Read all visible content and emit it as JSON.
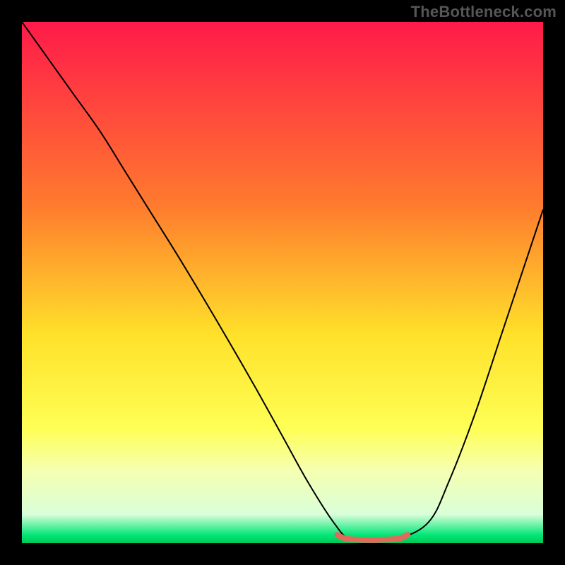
{
  "watermark": "TheBottleneck.com",
  "chart_data": {
    "type": "line",
    "title": "",
    "xlabel": "",
    "ylabel": "",
    "xlim": [
      0,
      100
    ],
    "ylim": [
      0,
      100
    ],
    "background_gradient": [
      {
        "offset": 0.0,
        "color": "#ff1a4a"
      },
      {
        "offset": 0.35,
        "color": "#ff7a2e"
      },
      {
        "offset": 0.6,
        "color": "#ffe12a"
      },
      {
        "offset": 0.78,
        "color": "#feff55"
      },
      {
        "offset": 0.86,
        "color": "#f6ffb0"
      },
      {
        "offset": 0.945,
        "color": "#d9ffd9"
      },
      {
        "offset": 0.985,
        "color": "#00e676"
      },
      {
        "offset": 1.0,
        "color": "#00c853"
      }
    ],
    "series": [
      {
        "name": "bottleneck-curve",
        "color": "#000000",
        "stroke_width": 2,
        "x": [
          0,
          5,
          10,
          15,
          20,
          25,
          30,
          35,
          40,
          45,
          50,
          55,
          60,
          63,
          68,
          72,
          78,
          82,
          87,
          92,
          96,
          100
        ],
        "y": [
          100,
          93,
          86,
          79,
          71,
          63,
          55,
          46.7,
          38.2,
          29.5,
          20.5,
          11.5,
          3.7,
          0.8,
          0.6,
          0.8,
          4.0,
          12,
          25,
          40,
          52,
          64
        ]
      },
      {
        "name": "optimal-zone",
        "color": "#e26a5a",
        "stroke_width": 8,
        "linecap": "round",
        "x": [
          60.5,
          62.0,
          64.0,
          66.0,
          68.0,
          70.0,
          72.5,
          74.0
        ],
        "y": [
          1.6,
          0.9,
          0.7,
          0.6,
          0.6,
          0.7,
          0.9,
          1.6
        ]
      }
    ]
  }
}
